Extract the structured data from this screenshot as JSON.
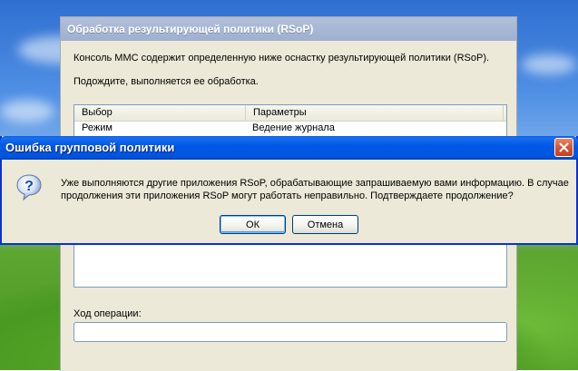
{
  "rsop_window": {
    "title": "Обработка результирующей политики (RSoP)",
    "description": "Консоль MMC содержит определенную ниже оснастку результирующей политики (RSoP).",
    "wait_text": "Подождите, выполняется ее обработка.",
    "list": {
      "columns": [
        "Выбор",
        "Параметры"
      ],
      "rows": [
        {
          "selection": "Режим",
          "parameters": "Ведение журнала"
        }
      ]
    },
    "progress_label": "Ход операции:",
    "progress": 0
  },
  "error_dialog": {
    "title": "Ошибка групповой политики",
    "icon": "question-icon",
    "message": "Уже выполняются другие приложения RSoP, обрабатывающие запрашиваемую вами информацию. В случае продолжения эти приложения RSoP могут работать неправильно. Подтверждаете продолжение?",
    "ok_label": "ОК",
    "cancel_label": "Отмена",
    "close_icon": "close-icon"
  },
  "colors": {
    "dialog_title_blue": "#0055dd",
    "close_red": "#d6552f",
    "window_face": "#ece9d8"
  }
}
